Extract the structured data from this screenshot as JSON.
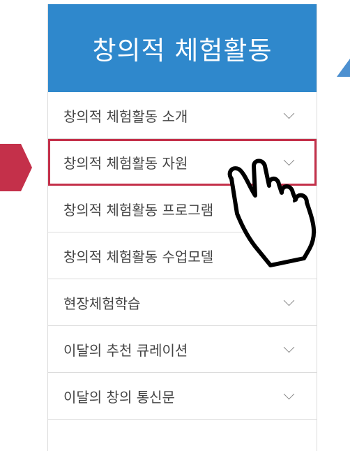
{
  "panel": {
    "title": "창의적 체험활동"
  },
  "menu": {
    "items": [
      {
        "label": "창의적 체험활동 소개",
        "icon": "chevron-down-icon"
      },
      {
        "label": "창의적 체험활동 자원",
        "icon": "chevron-down-icon"
      },
      {
        "label": "창의적 체험활동 프로그램",
        "icon": "chevron-down-icon"
      },
      {
        "label": "창의적 체험활동 수업모델",
        "icon": "chevron-down-icon"
      },
      {
        "label": "현장체험학습",
        "icon": "chevron-down-icon"
      },
      {
        "label": "이달의 추천 큐레이션",
        "icon": "chevron-down-icon"
      },
      {
        "label": "이달의 창의 통신문",
        "icon": "chevron-down-icon"
      }
    ]
  },
  "colors": {
    "header_bg": "#2f88cc",
    "highlight_border": "#c4304a",
    "pointer_arrow": "#c4304a",
    "accent_arrow": "#4d90d0"
  },
  "icons": {
    "pointer_arrow": "right-arrow-icon",
    "accent_arrow": "up-triangle-icon",
    "cursor": "hand-cursor-icon"
  }
}
